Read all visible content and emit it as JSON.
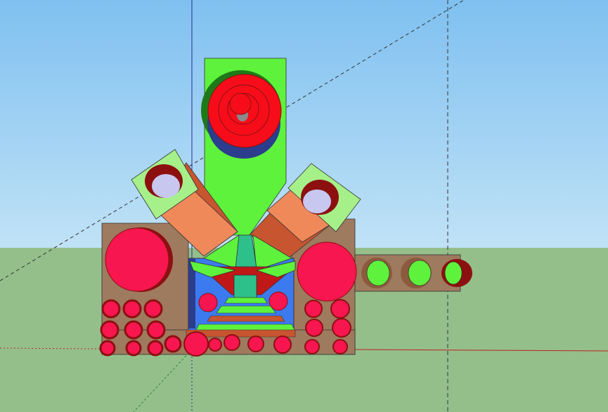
{
  "viewport": {
    "kind": "3d-modeling-viewport",
    "sky_top_color": "#7fc0f0",
    "sky_bottom_color": "#bfe2f7",
    "ground_color": "#94bf8b",
    "axis_colors": {
      "blue_axis": "#2a2a9a",
      "red_axis": "#c02020",
      "green_axis": "#2a8a2a"
    }
  },
  "model": {
    "colors": {
      "brown": "#9e7a5e",
      "bright_green": "#5ef23c",
      "dark_green": "#1e7a18",
      "pale_green": "#a6f08a",
      "orange": "#f0895a",
      "rust": "#c75530",
      "red": "#f70d1a",
      "pink_red": "#f7164f",
      "dark_red": "#8c1010",
      "navy": "#2b3d8c",
      "lavender": "#c7c7f0",
      "teal": "#2ec08a",
      "blue": "#3c7af0"
    }
  }
}
